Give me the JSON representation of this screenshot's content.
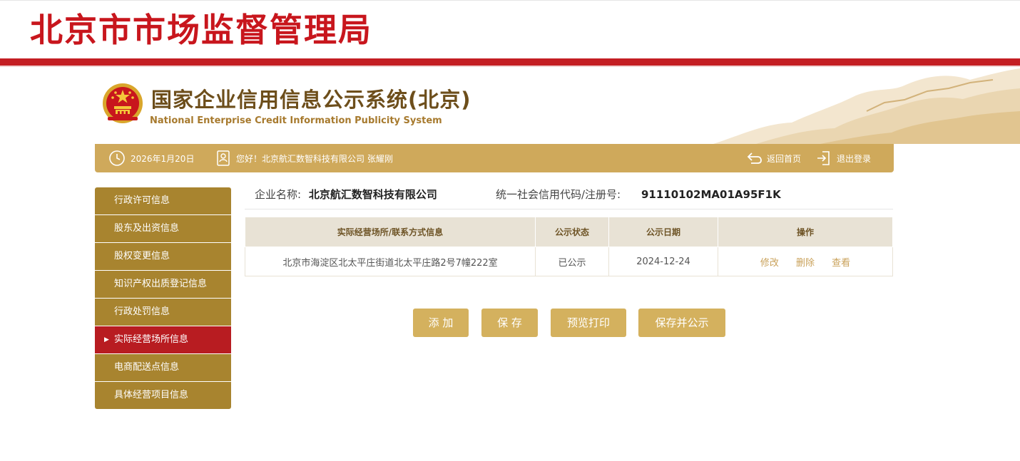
{
  "agency": {
    "title": "北京市市场监督管理局"
  },
  "system": {
    "title_cn": "国家企业信用信息公示系统(北京)",
    "title_en": "National Enterprise Credit Information Publicity System"
  },
  "nav": {
    "date": "2026年1月20日",
    "greeting": "您好！北京航汇数智科技有限公司  张耀刚",
    "home_label": "返回首页",
    "logout_label": "退出登录"
  },
  "sidebar": {
    "items": [
      {
        "label": "行政许可信息",
        "active": false
      },
      {
        "label": "股东及出资信息",
        "active": false
      },
      {
        "label": "股权变更信息",
        "active": false
      },
      {
        "label": "知识产权出质登记信息",
        "active": false
      },
      {
        "label": "行政处罚信息",
        "active": false
      },
      {
        "label": "实际经营场所信息",
        "active": true
      },
      {
        "label": "电商配送点信息",
        "active": false
      },
      {
        "label": "具体经营项目信息",
        "active": false
      }
    ],
    "active_marker": "▶"
  },
  "company": {
    "name_label": "企业名称:",
    "name": "北京航汇数智科技有限公司",
    "code_label": "统一社会信用代码/注册号:",
    "code": "91110102MA01A95F1K"
  },
  "table": {
    "headers": [
      "实际经营场所/联系方式信息",
      "公示状态",
      "公示日期",
      "操作"
    ],
    "rows": [
      {
        "address": "北京市海淀区北太平庄街道北太平庄路2号7幢222室",
        "status": "已公示",
        "date": "2024-12-24",
        "actions": [
          "修改",
          "删除",
          "查看"
        ]
      }
    ]
  },
  "buttons": {
    "add": "添 加",
    "save": "保 存",
    "print_preview": "预览打印",
    "save_publish": "保存并公示"
  },
  "colors": {
    "agency_red": "#c8161d",
    "band_red": "#c41e23",
    "gold": "#cfa95b",
    "menu_brown": "#a8842f",
    "menu_active": "#b81c21",
    "button_gold": "#d4b15e"
  }
}
